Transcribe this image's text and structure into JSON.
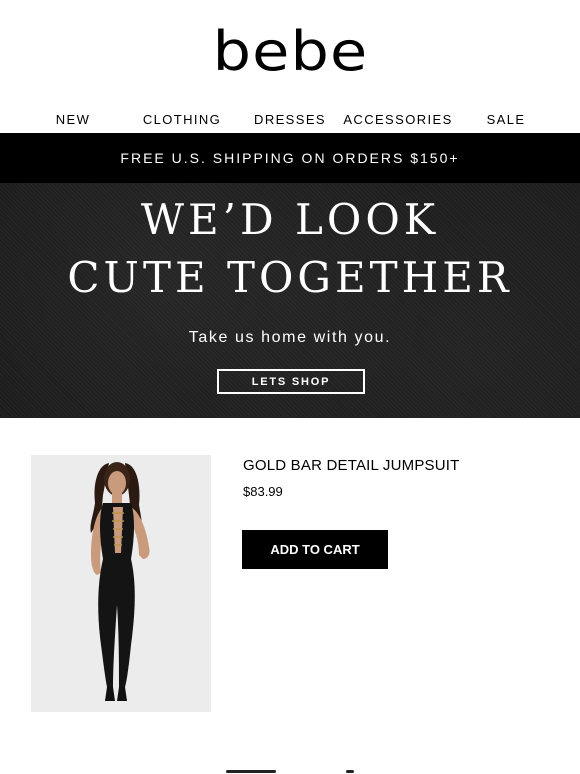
{
  "brand": {
    "logo_text": "bebe"
  },
  "nav": {
    "items": [
      {
        "label": "NEW"
      },
      {
        "label": "CLOTHING"
      },
      {
        "label": "DRESSES"
      },
      {
        "label": "ACCESSORIES"
      },
      {
        "label": "SALE"
      }
    ]
  },
  "shipping_banner": {
    "text": "FREE U.S. SHIPPING ON ORDERS $150+"
  },
  "hero": {
    "headline_line1": "WE’D LOOK",
    "headline_line2": "CUTE TOGETHER",
    "subheadline": "Take us home with you.",
    "cta_label": "LETS SHOP"
  },
  "product": {
    "name": "GOLD BAR DETAIL JUMPSUIT",
    "price": "$83.99",
    "cta_label": "ADD TO CART"
  },
  "colors": {
    "background": "#ffffff",
    "banner_bg": "#000000",
    "hero_bg": "#1e1e1e",
    "product_image_bg": "#ececec",
    "button_bg": "#000000"
  }
}
